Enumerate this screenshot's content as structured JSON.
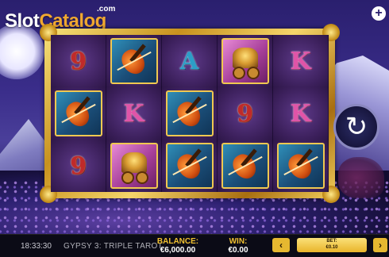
{
  "logo": {
    "slot": "Slot",
    "catalog": "Catalog",
    "com": ".com"
  },
  "plus_icon": "+",
  "spin_icon": "↻",
  "reels": [
    [
      "9",
      "violin",
      "9"
    ],
    [
      "violin",
      "K",
      "wagon"
    ],
    [
      "A",
      "violin",
      "violin"
    ],
    [
      "wagon",
      "9",
      "violin"
    ],
    [
      "K",
      "K",
      "violin"
    ]
  ],
  "bottom_bar": {
    "time": "18:33:30",
    "game_name": "GYPSY 3: TRIPLE TAROT",
    "balance_label": "BALANCE:",
    "balance_value": "€6,000.00",
    "win_label": "WIN:",
    "win_value": "€0.00",
    "bet_label": "BET:",
    "bet_value": "€0.10",
    "prev_icon": "‹",
    "next_icon": "›"
  },
  "colors": {
    "accent": "#f0c030",
    "frame_gold": "#c8921e",
    "background": "#2a1f6e"
  }
}
